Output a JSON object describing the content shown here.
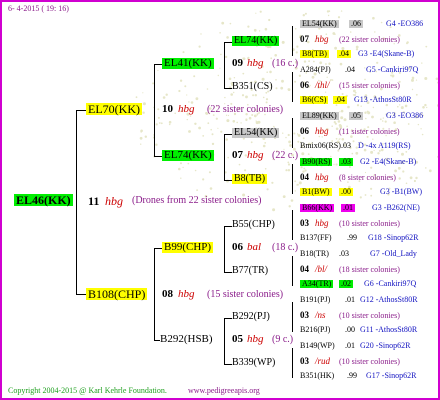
{
  "header": {
    "date": "6- 4-2015 ( 19: 16)"
  },
  "footer": {
    "copyright": "Copyright 2004-2015 @ Karl Kehrle Foundation.",
    "site": "www.pedigreeapis.org"
  },
  "root": {
    "name": "EL46(KK)",
    "count": "11",
    "hbg": "hbg",
    "note": "(Drones from 22 sister colonies)"
  },
  "gen1": {
    "top": {
      "name": "EL70(KK)",
      "count": "10",
      "hbg": "hbg",
      "note": "(22 sister colonies)"
    },
    "bottom": {
      "name": "B108(CHP)",
      "count": "08",
      "hbg": "hbg",
      "note": "(15 sister colonies)"
    }
  },
  "gen2": {
    "a": {
      "name": "EL41(KK)",
      "count": "09",
      "hbg": "hbg",
      "note": "(16 c.)"
    },
    "b": {
      "name": "EL74(KK)",
      "count": "07",
      "hbg": "hbg",
      "note": "(22 c.)"
    },
    "c": {
      "name": "B99(CHP)",
      "count": "06",
      "hbg": "bal",
      "note": "(18 c.)"
    },
    "d": {
      "name": "B292(HSB)",
      "count": "05",
      "hbg": "hbg",
      "note": "(9 c.)"
    }
  },
  "gen3": {
    "a1": {
      "name": "EL74(KK)"
    },
    "a2": {
      "name": "B351(CS)"
    },
    "b1": {
      "name": "EL54(KK)"
    },
    "b2": {
      "name": "B8(TB)"
    },
    "c1": {
      "name": "B55(CHP)"
    },
    "c2": {
      "name": "B77(TR)"
    },
    "d1": {
      "name": "B292(PJ)"
    },
    "d2": {
      "name": "B339(WP)"
    }
  },
  "gen4": [
    {
      "name": "EL54(KK)",
      "val": ".06",
      "code": "G4 -EO386"
    },
    {
      "count": "07",
      "hbg": "hbg",
      "note": "(22 sister colonies)"
    },
    {
      "name": "B8(TB)",
      "val": ".04",
      "code": "G3 -E4(Skane-B)"
    },
    {
      "name": "A284(PJ)",
      "val": ".04",
      "code": "G5 -Cankiri97Q"
    },
    {
      "count": "06",
      "hbg": "/thl/",
      "note": "(15 sister colonies)"
    },
    {
      "name": "B6(CS)",
      "val": ".04",
      "code": "G13 -AthosSt80R"
    },
    {
      "name": "EL89(KK)",
      "val": ".05",
      "code": "G3 -EO386"
    },
    {
      "count": "06",
      "hbg": "hbg",
      "note": "(11 sister colonies)"
    },
    {
      "name": "Bmix06(RS)",
      "val": ".03",
      "code": "D -4x A119(RS)"
    },
    {
      "name": "B90(RS)",
      "val": ".03",
      "code": "G2 -E4(Skane-B)"
    },
    {
      "count": "04",
      "hbg": "hbg",
      "note": "(8 sister colonies)"
    },
    {
      "name": "B1(BW)",
      "val": ".00",
      "code": "G3 -B1(BW)"
    },
    {
      "name": "B66(KK)",
      "val": ".01",
      "code": "G3 -B262(NE)"
    },
    {
      "count": "03",
      "hbg": "hbg",
      "note": "(10 sister colonies)"
    },
    {
      "name": "B137(FF)",
      "val": ".99",
      "code": "G18 -Sinop62R"
    },
    {
      "name": "B18(TR)",
      "val": ".03",
      "code": "G7 -Old_Lady"
    },
    {
      "count": "04",
      "hbg": "/bl/",
      "note": "(18 sister colonies)"
    },
    {
      "name": "A34(TR)",
      "val": ".02",
      "code": "G6 -Cankiri97Q"
    },
    {
      "name": "B191(PJ)",
      "val": ".01",
      "code": "G12 -AthosSt80R"
    },
    {
      "count": "03",
      "hbg": "/ns",
      "note": "(10 sister colonies)"
    },
    {
      "name": "B216(PJ)",
      "val": ".00",
      "code": "G11 -AthosSt80R"
    },
    {
      "name": "B149(WP)",
      "val": ".01",
      "code": "G20 -Sinop62R"
    },
    {
      "count": "03",
      "hbg": "/rud",
      "note": "(10 sister colonies)"
    },
    {
      "name": "B351(HK)",
      "val": ".99",
      "code": "G17 -Sinop62R"
    }
  ]
}
